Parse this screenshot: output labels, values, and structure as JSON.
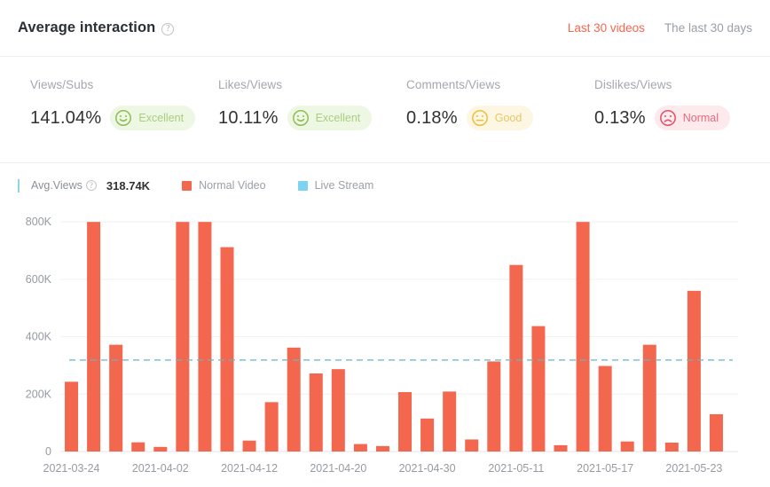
{
  "header": {
    "title": "Average interaction",
    "help_icon": "question-circle-icon",
    "tabs": [
      {
        "label": "Last 30 videos",
        "active": true
      },
      {
        "label": "The last 30 days",
        "active": false
      }
    ]
  },
  "metrics": [
    {
      "label": "Views/Subs",
      "value": "141.04%",
      "rating": "Excellent",
      "rating_class": "excellent",
      "face": "smile-face-icon",
      "color": "#a9ce80"
    },
    {
      "label": "Likes/Views",
      "value": "10.11%",
      "rating": "Excellent",
      "rating_class": "excellent",
      "face": "smile-face-icon",
      "color": "#a9ce80"
    },
    {
      "label": "Comments/Views",
      "value": "0.18%",
      "rating": "Good",
      "rating_class": "good",
      "face": "neutral-face-icon",
      "color": "#e9c767"
    },
    {
      "label": "Dislikes/Views",
      "value": "0.13%",
      "rating": "Normal",
      "rating_class": "normal",
      "face": "frown-face-icon",
      "color": "#ea6a7d"
    }
  ],
  "legend": {
    "avg_label": "Avg.Views",
    "avg_help_icon": "question-circle-icon",
    "avg_value": "318.74K",
    "items": [
      {
        "label": "Normal Video",
        "color": "#f4674f"
      },
      {
        "label": "Live Stream",
        "color": "#7fd3f0"
      }
    ]
  },
  "colors": {
    "accent": "#f4674f",
    "bar": "#f4674f",
    "live_stream": "#7fd3f0",
    "avg_line": "#67b5c4",
    "grid": "#eef0f2",
    "axis_text": "#959ba1"
  },
  "chart_data": {
    "type": "bar",
    "title": "",
    "xlabel": "",
    "ylabel": "",
    "ylim": [
      0,
      850000
    ],
    "y_ticks": [
      0,
      200000,
      400000,
      600000,
      800000
    ],
    "y_tick_labels": [
      "0",
      "200K",
      "400K",
      "600K",
      "800K"
    ],
    "grid": true,
    "legend_position": "top-left",
    "series_name": "Normal Video",
    "average_line": {
      "label": "Avg.Views",
      "value": 318740,
      "display": "318.74K",
      "style": "dashed"
    },
    "x_tick_labels": [
      "2021-03-24",
      "2021-04-02",
      "2021-04-12",
      "2021-04-20",
      "2021-04-30",
      "2021-05-11",
      "2021-05-17",
      "2021-05-23"
    ],
    "x_tick_indices": [
      0,
      4,
      8,
      12,
      16,
      20,
      24,
      28
    ],
    "categories": [
      "1",
      "2",
      "3",
      "4",
      "5",
      "6",
      "7",
      "8",
      "9",
      "10",
      "11",
      "12",
      "13",
      "14",
      "15",
      "16",
      "17",
      "18",
      "19",
      "20",
      "21",
      "22",
      "23",
      "24",
      "25",
      "26",
      "27",
      "28",
      "29",
      "30"
    ],
    "values": [
      243000,
      800000,
      372000,
      32000,
      16000,
      800000,
      800000,
      712000,
      38000,
      172000,
      362000,
      272000,
      287000,
      26000,
      19000,
      207000,
      115000,
      209000,
      42000,
      314000,
      650000,
      437000,
      22000,
      800000,
      298000,
      35000,
      372000,
      31000,
      560000,
      130000
    ]
  }
}
